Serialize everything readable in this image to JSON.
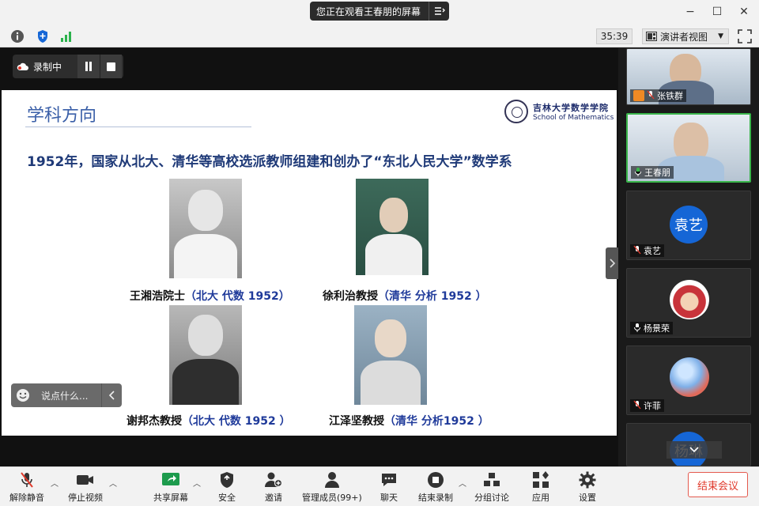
{
  "titlebar": {
    "sharing_text": "您正在观看王春朋的屏幕",
    "minimize": "−",
    "maximize": "☐",
    "close": "✕"
  },
  "toolrow": {
    "timer": "35:39",
    "view_mode": "演讲者视图"
  },
  "recording": {
    "label": "录制中"
  },
  "slide": {
    "title": "学科方向",
    "logo_cn": "吉林大学数学学院",
    "logo_en": "School of Mathematics",
    "headline": "1952年，国家从北大、清华等高校选派教师组建和创办了“东北人民大学”数学系",
    "people": [
      {
        "name": "王湘浩院士",
        "detail": "（北大 代数 1952）"
      },
      {
        "name": "徐利治教授",
        "detail": "（清华 分析 1952 ）"
      },
      {
        "name": "谢邦杰教授",
        "detail": "（北大 代数 1952 ）"
      },
      {
        "name": "江泽坚教授",
        "detail": "（清华 分析1952 ）"
      }
    ]
  },
  "chat": {
    "placeholder": "说点什么..."
  },
  "participants": [
    {
      "name": "张铁群",
      "type": "video"
    },
    {
      "name": "王春朋",
      "type": "video",
      "active": true
    },
    {
      "name": "袁艺",
      "type": "avatar_text",
      "avatar": "袁艺"
    },
    {
      "name": "杨景荣",
      "type": "avatar_img"
    },
    {
      "name": "许菲",
      "type": "avatar_img"
    },
    {
      "name": "",
      "type": "avatar_text",
      "avatar": "杨琳"
    }
  ],
  "bottombar": {
    "unmute": "解除静音",
    "stop_video": "停止视频",
    "share_screen": "共享屏幕",
    "security": "安全",
    "invite": "邀请",
    "manage_members": "管理成员(99+)",
    "chat": "聊天",
    "end_recording": "结束录制",
    "breakout": "分组讨论",
    "apps": "应用",
    "settings": "设置",
    "end_meeting": "结束会议"
  },
  "colors": {
    "accent_blue": "#1566d6",
    "active_green": "#39b54a",
    "end_red": "#e0392b",
    "slide_blue": "#1f3a78"
  }
}
